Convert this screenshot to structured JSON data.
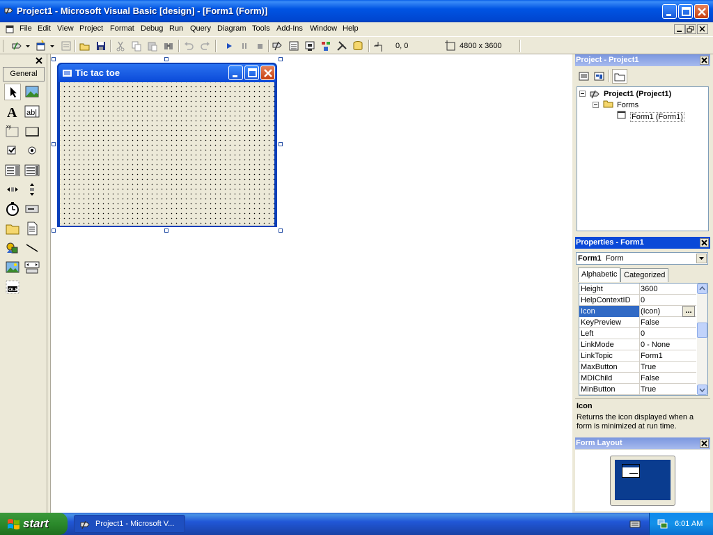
{
  "window": {
    "title": "Project1 - Microsoft Visual Basic [design] - [Form1 (Form)]"
  },
  "menu": [
    "File",
    "Edit",
    "View",
    "Project",
    "Format",
    "Debug",
    "Run",
    "Query",
    "Diagram",
    "Tools",
    "Add-Ins",
    "Window",
    "Help"
  ],
  "toolbar": {
    "position": "0, 0",
    "size": "4800 x 3600"
  },
  "toolbox": {
    "tab": "General"
  },
  "form": {
    "caption": "Tic tac toe"
  },
  "project": {
    "title": "Project - Project1",
    "root": "Project1 (Project1)",
    "folder": "Forms",
    "item": "Form1 (Form1)"
  },
  "properties": {
    "title": "Properties - Form1",
    "object": "Form1",
    "object_type": "Form",
    "tabs": [
      "Alphabetic",
      "Categorized"
    ],
    "rows": [
      {
        "name": "Height",
        "value": "3600"
      },
      {
        "name": "HelpContextID",
        "value": "0"
      },
      {
        "name": "Icon",
        "value": "(Icon)"
      },
      {
        "name": "KeyPreview",
        "value": "False"
      },
      {
        "name": "Left",
        "value": "0"
      },
      {
        "name": "LinkMode",
        "value": "0 - None"
      },
      {
        "name": "LinkTopic",
        "value": "Form1"
      },
      {
        "name": "MaxButton",
        "value": "True"
      },
      {
        "name": "MDIChild",
        "value": "False"
      },
      {
        "name": "MinButton",
        "value": "True"
      }
    ],
    "ellipsis": "...",
    "desc_title": "Icon",
    "desc_text": "Returns the icon displayed when a form is minimized at run time."
  },
  "layout": {
    "title": "Form Layout"
  },
  "taskbar": {
    "start": "start",
    "item": "Project1 - Microsoft V...",
    "clock": "6:01 AM"
  },
  "colors": {
    "selection": "#316AC5",
    "title_active": "#0054E3",
    "title_inactive": "#7A96DF"
  }
}
